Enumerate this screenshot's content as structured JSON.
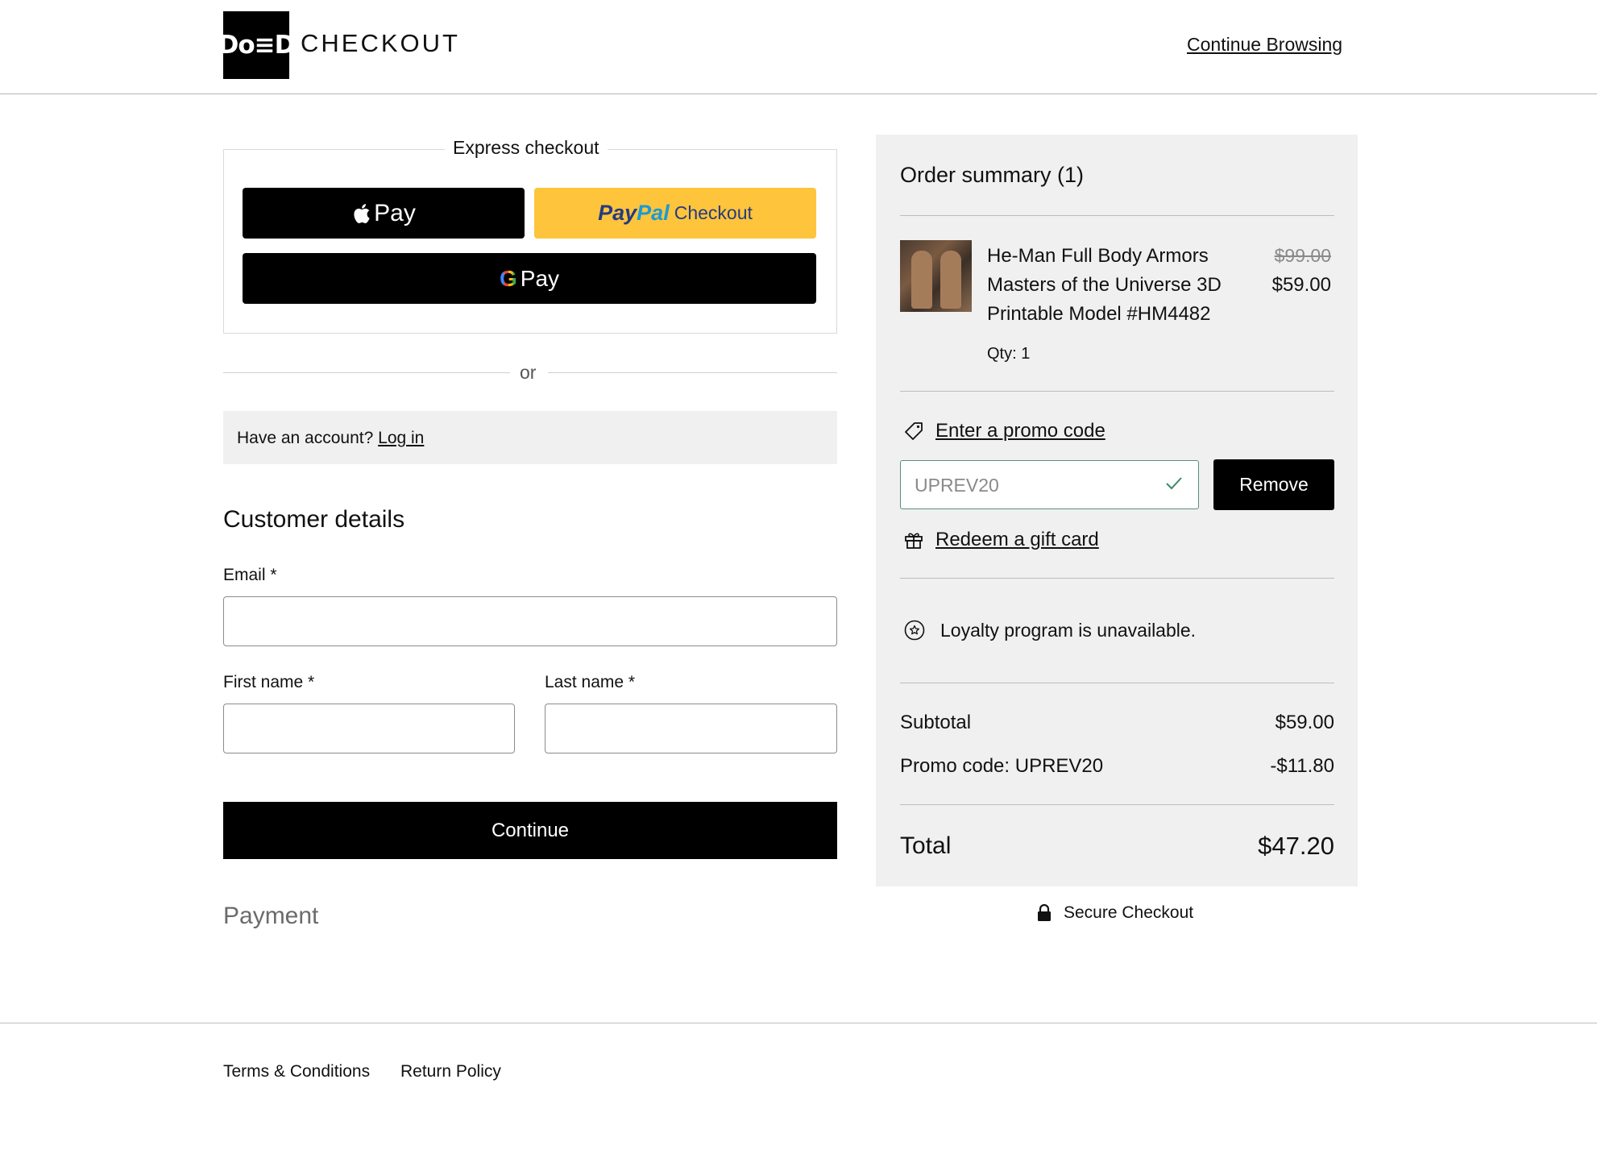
{
  "header": {
    "logo_text": "Do≡D",
    "title": "CHECKOUT",
    "continue_browsing": "Continue Browsing"
  },
  "express": {
    "legend": "Express checkout",
    "apple_pay_label": "Pay",
    "paypal_pay": "Pay",
    "paypal_pal": "Pal",
    "paypal_checkout": "Checkout",
    "gpay_g": "G",
    "gpay_label": "Pay"
  },
  "divider": {
    "or_text": "or"
  },
  "account": {
    "prompt": "Have an account?",
    "login_link": "Log in"
  },
  "customer_details": {
    "title": "Customer details",
    "email_label": "Email *",
    "email_value": "",
    "first_name_label": "First name *",
    "first_name_value": "",
    "last_name_label": "Last name *",
    "last_name_value": "",
    "continue_label": "Continue"
  },
  "payment": {
    "title": "Payment"
  },
  "summary": {
    "title": "Order summary (1)",
    "item": {
      "name": "He-Man Full Body Armors Masters of the Universe 3D Printable Model #HM4482",
      "old_price": "$99.00",
      "price": "$59.00",
      "qty": "Qty: 1"
    },
    "promo_link": "Enter a promo code",
    "promo_value": "UPREV20",
    "remove_label": "Remove",
    "gift_card_link": "Redeem a gift card",
    "loyalty_text": "Loyalty program is unavailable.",
    "subtotal_label": "Subtotal",
    "subtotal_value": "$59.00",
    "promo_line_label": "Promo code: UPREV20",
    "promo_line_value": "-$11.80",
    "total_label": "Total",
    "total_value": "$47.20"
  },
  "secure": {
    "label": "Secure Checkout"
  },
  "footer": {
    "terms": "Terms & Conditions",
    "returns": "Return Policy"
  },
  "colors": {
    "paypal_yellow": "#fec43b",
    "promo_valid_green": "#5a8f7b",
    "summary_bg": "#f0f0f0"
  },
  "icons": [
    "apple-icon",
    "google-icon",
    "tag-icon",
    "check-icon",
    "gift-icon",
    "star-circle-icon",
    "lock-icon"
  ]
}
